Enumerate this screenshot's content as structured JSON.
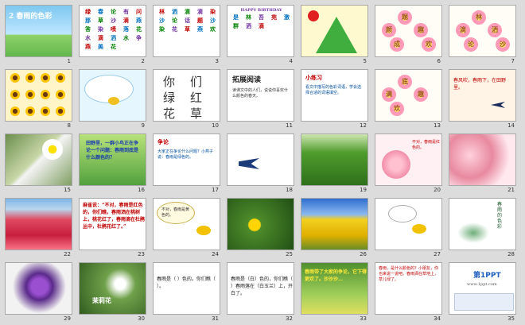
{
  "window": {
    "title": ""
  },
  "slides": [
    {
      "num": "1",
      "kind": "title",
      "title": "2 春雨的色彩"
    },
    {
      "num": "2",
      "kind": "grid",
      "text": [
        "绿",
        "春",
        "论",
        "有",
        "问",
        "那",
        "草",
        "沙",
        "滴",
        "燕",
        "答",
        "染",
        "喷",
        "落",
        "花",
        "水",
        "滴",
        "洒",
        "水",
        "争",
        "燕",
        "美",
        "花"
      ]
    },
    {
      "num": "3",
      "kind": "grid",
      "text": [
        "林",
        "洒",
        "滴",
        "滴",
        "染",
        "沙",
        "论",
        "话",
        "题",
        "沙",
        "染",
        "花",
        "草",
        "燕",
        "欢"
      ]
    },
    {
      "num": "4",
      "kind": "grid",
      "text": [
        "HAPPY BIRTHDAY",
        "是",
        "林",
        "吾",
        "苑",
        "激",
        "群",
        "洒",
        "滴"
      ]
    },
    {
      "num": "5",
      "kind": "pyramid",
      "text": ""
    },
    {
      "num": "6",
      "kind": "flowers",
      "text": [
        "题",
        "颜",
        "趣",
        "成",
        "欢"
      ]
    },
    {
      "num": "7",
      "kind": "flowers",
      "text": [
        "林",
        "滴",
        "洒",
        "论",
        "沙"
      ]
    },
    {
      "num": "8",
      "kind": "sunflowers",
      "text": ""
    },
    {
      "num": "9",
      "kind": "cloud",
      "text": ""
    },
    {
      "num": "10",
      "kind": "chars",
      "text": [
        "你",
        "们",
        "绿",
        "红",
        "花",
        "草"
      ]
    },
    {
      "num": "11",
      "kind": "reading",
      "title": "拓展阅读",
      "text": "读课文中的人们，说说你喜欢什么颜色的春天。"
    },
    {
      "num": "12",
      "kind": "note",
      "title": "小练习",
      "text": "看文中描写的色彩词语，学会选择合适的词语填空。"
    },
    {
      "num": "13",
      "kind": "flowers2",
      "text": [
        "底",
        "满",
        "趣",
        "欢"
      ]
    },
    {
      "num": "14",
      "kind": "swallowtext",
      "text": "春风吹，春雨下，在田野里。"
    },
    {
      "num": "15",
      "kind": "photo",
      "text": ""
    },
    {
      "num": "16",
      "kind": "question",
      "text": "田野里，一群小鸟正在争论一个问题：春雨到底是什么颜色的？"
    },
    {
      "num": "17",
      "kind": "note2",
      "title": "争论",
      "text": "大家正在争论什么问题？小燕子说：春雨是绿色的。"
    },
    {
      "num": "18",
      "kind": "swallow",
      "text": ""
    },
    {
      "num": "19",
      "kind": "grass",
      "text": ""
    },
    {
      "num": "20",
      "kind": "birdspeech",
      "text": "不对，春雨是红色的。"
    },
    {
      "num": "21",
      "kind": "blossom",
      "text": ""
    },
    {
      "num": "22",
      "kind": "redflowers",
      "text": ""
    },
    {
      "num": "23",
      "kind": "bigtext",
      "text": "麻雀说：“不对，春雨是红色的，你们瞧，春雨洒在桃树上，桃花红了，春雨滴在杜鹃丛中，杜鹃花红了。”"
    },
    {
      "num": "24",
      "kind": "speech",
      "text": "不对，春雨是黄色的。"
    },
    {
      "num": "25",
      "kind": "dandelion",
      "text": ""
    },
    {
      "num": "26",
      "kind": "field",
      "text": ""
    },
    {
      "num": "27",
      "kind": "oriole",
      "text": ""
    },
    {
      "num": "28",
      "kind": "ink",
      "text": "春雨的色彩"
    },
    {
      "num": "29",
      "kind": "purple",
      "text": ""
    },
    {
      "num": "30",
      "kind": "jasmine",
      "text": "茉莉花"
    },
    {
      "num": "31",
      "kind": "fill",
      "text": "春雨是（ ）色的。你们瞧（ ）。"
    },
    {
      "num": "32",
      "kind": "fill",
      "text": "春雨是（白）色的，你们瞧（ ）春雨落在（白玉兰）上，开白了。"
    },
    {
      "num": "33",
      "kind": "poem",
      "text": "春雨带了大家的争论，它下得更欢了。沙沙沙…"
    },
    {
      "num": "34",
      "kind": "textblock",
      "text": "春雨，是什么颜色的？小朋友，你也来说一说吧。春雨洒在草地上，草儿绿了。"
    },
    {
      "num": "35",
      "kind": "ppt",
      "title": "第1PPT",
      "text": "www.1ppt.com"
    }
  ]
}
